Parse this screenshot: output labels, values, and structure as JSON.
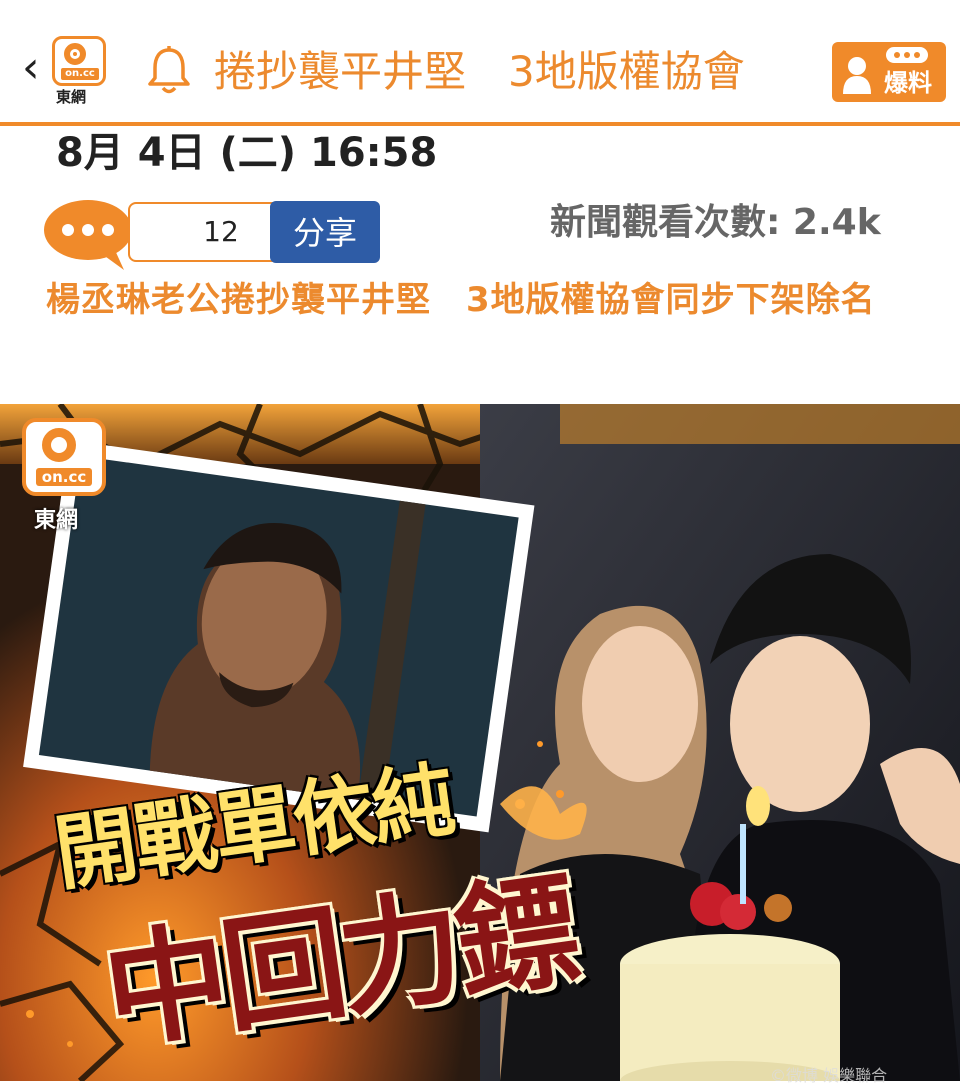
{
  "header": {
    "back_icon": "chevron-left-icon",
    "logo": {
      "brand": "on.cc",
      "name": "東網"
    },
    "bell_icon": "bell-icon",
    "marquee_text": "捲抄襲平井堅　3地版權協會",
    "report_button": {
      "icon": "person-chat-icon",
      "label": "爆料"
    },
    "accent_color": "#f08a2a"
  },
  "article": {
    "datetime": "8月 4日 (二) 16:58",
    "comment_count": "12",
    "share_label": "分享",
    "views": "新聞觀看次數: 2.4k",
    "headline": "楊丞琳老公捲抄襲平井堅　3地版權協會同步下架除名"
  },
  "hero": {
    "logo": {
      "brand": "on.cc",
      "name": "東網"
    },
    "title_line1": "開戰單依純",
    "title_line2": "中回力鏢",
    "watermark": "©微博 娛樂聯合",
    "title_color": "#ffe16a",
    "title2_color": "#8a1515"
  }
}
